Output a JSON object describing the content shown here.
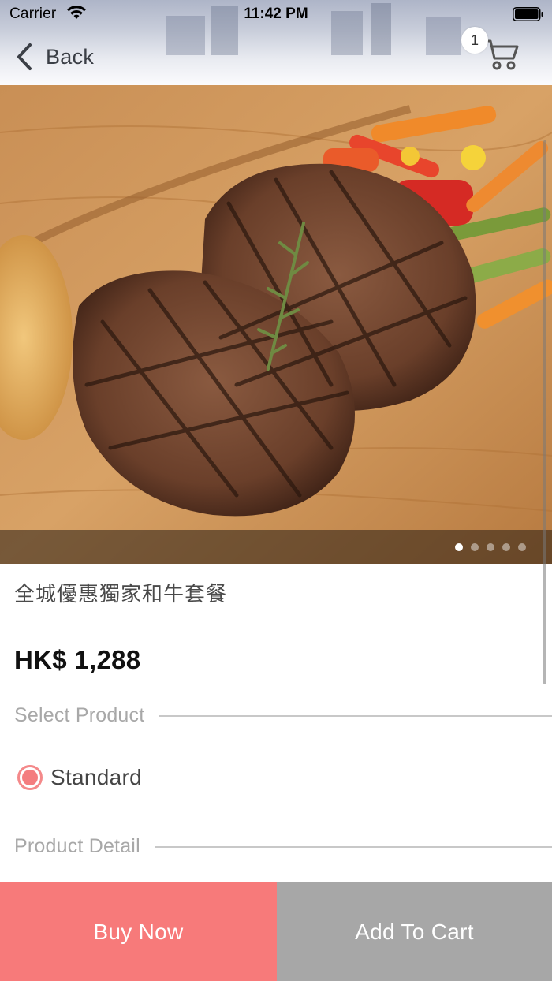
{
  "status_bar": {
    "carrier": "Carrier",
    "time": "11:42 PM",
    "wifi_icon": "wifi-icon",
    "battery_icon": "battery-icon"
  },
  "nav": {
    "back_label": "Back",
    "back_icon": "chevron-left-icon",
    "cart_icon": "shopping-cart-icon",
    "cart_count": "1"
  },
  "gallery": {
    "page_count": 5,
    "active_index": 0
  },
  "product": {
    "title": "全城優惠獨家和牛套餐",
    "price": "HK$ 1,288"
  },
  "sections": {
    "select_product": "Select Product",
    "product_detail": "Product Detail"
  },
  "options": [
    {
      "label": "Standard",
      "selected": true
    }
  ],
  "actions": {
    "buy_now": "Buy Now",
    "add_to_cart": "Add To Cart"
  },
  "colors": {
    "accent": "#f77a7a",
    "secondary_button": "#a7a7a7",
    "radio": "#f47d7f"
  }
}
